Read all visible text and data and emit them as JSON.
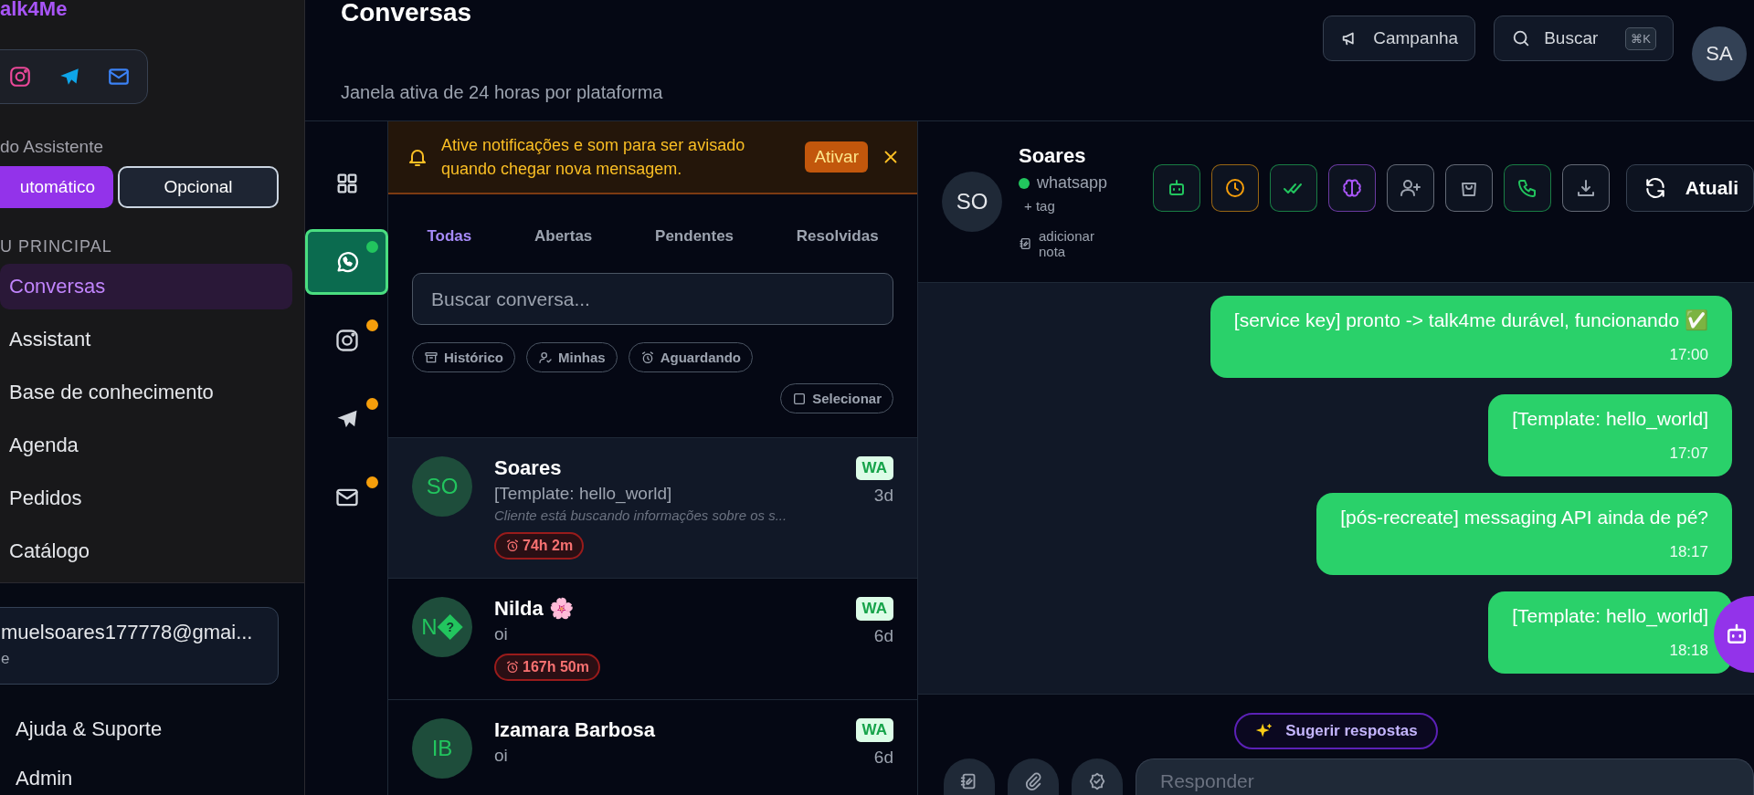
{
  "sidebar": {
    "logo": "alk4Me",
    "social": [
      {
        "kind": "instagram"
      },
      {
        "kind": "telegram"
      },
      {
        "kind": "mail"
      }
    ],
    "assistant_label": "do Assistente",
    "assistant_modes": [
      {
        "label": "utomático",
        "selected": true
      },
      {
        "label": "Opcional",
        "selected": false
      }
    ],
    "section": "U PRINCIPAL",
    "nav": [
      {
        "label": "Conversas",
        "selected": true
      },
      {
        "label": "Assistant",
        "selected": false
      },
      {
        "label": "Base de conhecimento",
        "selected": false
      },
      {
        "label": "Agenda",
        "selected": false
      },
      {
        "label": "Pedidos",
        "selected": false
      },
      {
        "label": "Catálogo",
        "selected": false
      }
    ],
    "user": {
      "email": "muelsoares177778@gmai...",
      "role": "e"
    },
    "footer_links": [
      "Ajuda & Suporte",
      "Admin"
    ]
  },
  "header": {
    "title": "Conversas",
    "subtitle": "Janela ativa de 24 horas por plataforma",
    "buttons": [
      {
        "kind": "campaign",
        "label": "Campanha"
      },
      {
        "kind": "search",
        "label": "Buscar",
        "shortcut": "⌘K"
      }
    ],
    "avatar": "SA"
  },
  "channels": [
    {
      "kind": "grid",
      "selected": false
    },
    {
      "kind": "whatsapp",
      "selected": true,
      "color": "#22c55e"
    },
    {
      "kind": "instagram",
      "selected": false,
      "color": "#f59e0b"
    },
    {
      "kind": "telegram",
      "selected": false,
      "color": "#f59e0b"
    },
    {
      "kind": "mail",
      "selected": false,
      "color": "#f59e0b"
    }
  ],
  "banner": {
    "text": "Ative notificações e som para ser avisado quando chegar nova mensagem.",
    "button": "Ativar"
  },
  "list": {
    "tabs": [
      {
        "label": "Todas",
        "selected": true
      },
      {
        "label": "Abertas",
        "selected": false
      },
      {
        "label": "Pendentes",
        "selected": false
      },
      {
        "label": "Resolvidas",
        "selected": false
      }
    ],
    "search": {
      "placeholder": "Buscar conversa..."
    },
    "filters": [
      {
        "kind": "archive",
        "label": "Histórico"
      },
      {
        "kind": "user",
        "label": "Minhas"
      },
      {
        "kind": "alarm",
        "label": "Aguardando"
      }
    ],
    "select_label": "Selecionar",
    "conversations": [
      {
        "initials": "SO",
        "name": "Soares",
        "preview": "[Template: hello_world]",
        "summary": "Cliente está buscando informações sobre os s...",
        "timer": "74h 2m",
        "channel": "WA",
        "age": "3d",
        "selected": true
      },
      {
        "initials": "N",
        "glyph": "?",
        "name": "Nilda 🌸",
        "preview": "oi",
        "timer": "167h 50m",
        "channel": "WA",
        "age": "6d",
        "selected": false
      },
      {
        "initials": "IB",
        "name": "Izamara Barbosa",
        "preview": "oi",
        "channel": "WA",
        "age": "6d",
        "selected": false
      }
    ]
  },
  "chat": {
    "contact": {
      "initials": "SO",
      "name": "Soares",
      "channel": "whatsapp",
      "tag": "+ tag",
      "note": "adicionar nota"
    },
    "actions": [
      {
        "kind": "bot",
        "color": "#22c55e"
      },
      {
        "kind": "clock",
        "color": "#f59e0b"
      },
      {
        "kind": "double-check",
        "color": "#22c55e"
      },
      {
        "kind": "brain",
        "color": "#a855f7"
      },
      {
        "kind": "user-plus",
        "color": "#9ca3af"
      },
      {
        "kind": "bag",
        "color": "#9ca3af"
      },
      {
        "kind": "phone",
        "color": "#22c55e"
      },
      {
        "kind": "download",
        "color": "#9ca3af"
      }
    ],
    "refresh": "Atuali",
    "messages": [
      {
        "text": "[service key] pronto -> talk4me durável, funcionando ✅",
        "time": "17:00"
      },
      {
        "text": "[Template: hello_world]",
        "time": "17:07"
      },
      {
        "text": "[pós-recreate] messaging API ainda de pé?",
        "time": "18:17"
      },
      {
        "text": "[Template: hello_world]",
        "time": "18:18"
      }
    ],
    "suggest": "Sugerir respostas",
    "composer": {
      "placeholder": "Responder"
    }
  }
}
